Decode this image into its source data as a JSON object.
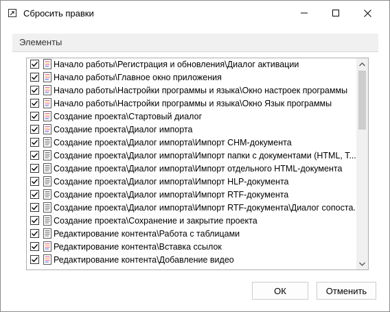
{
  "window": {
    "title": "Сбросить правки"
  },
  "group": {
    "header": "Элементы"
  },
  "items": [
    {
      "label": "Начало работы\\Регистрация и обновления\\Диалог активации",
      "checked": true,
      "icon": "doc-colored-icon"
    },
    {
      "label": "Начало работы\\Главное окно приложения",
      "checked": true,
      "icon": "doc-colored-icon"
    },
    {
      "label": "Начало работы\\Настройки программы и языка\\Окно настроек программы",
      "checked": true,
      "icon": "doc-colored-icon"
    },
    {
      "label": "Начало работы\\Настройки программы и языка\\Окно Язык программы",
      "checked": true,
      "icon": "doc-colored-icon"
    },
    {
      "label": "Создание проекта\\Стартовый диалог",
      "checked": true,
      "icon": "doc-colored-icon"
    },
    {
      "label": "Создание проекта\\Диалог импорта",
      "checked": true,
      "icon": "doc-colored-icon"
    },
    {
      "label": "Создание проекта\\Диалог импорта\\Импорт CHM-документа",
      "checked": true,
      "icon": "doc-plain-icon"
    },
    {
      "label": "Создание проекта\\Диалог импорта\\Импорт папки с документами (HTML, T...",
      "checked": true,
      "icon": "doc-plain-icon"
    },
    {
      "label": "Создание проекта\\Диалог импорта\\Импорт отдельного HTML-документа",
      "checked": true,
      "icon": "doc-plain-icon"
    },
    {
      "label": "Создание проекта\\Диалог импорта\\Импорт HLP-документа",
      "checked": true,
      "icon": "doc-plain-icon"
    },
    {
      "label": "Создание проекта\\Диалог импорта\\Импорт RTF-документа",
      "checked": true,
      "icon": "doc-plain-icon"
    },
    {
      "label": "Создание проекта\\Диалог импорта\\Импорт RTF-документа\\Диалог сопоста...",
      "checked": true,
      "icon": "doc-plain-icon"
    },
    {
      "label": "Создание проекта\\Сохранение и закрытие проекта",
      "checked": true,
      "icon": "doc-plain-icon"
    },
    {
      "label": "Редактирование контента\\Работа с таблицами",
      "checked": true,
      "icon": "doc-plain-icon"
    },
    {
      "label": "Редактирование контента\\Вставка ссылок",
      "checked": true,
      "icon": "doc-colored-icon"
    },
    {
      "label": "Редактирование контента\\Добавление видео",
      "checked": true,
      "icon": "doc-colored-icon"
    }
  ],
  "buttons": {
    "ok": "ОК",
    "cancel": "Отменить"
  },
  "colors": {
    "accent_pink": "#e060a0",
    "accent_orange": "#f0a040",
    "accent_blue": "#4060c0"
  }
}
